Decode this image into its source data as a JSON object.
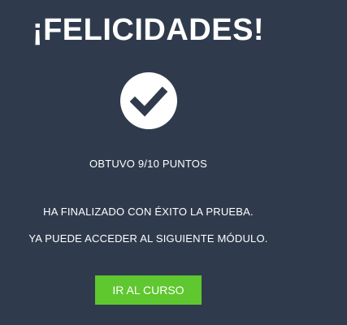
{
  "congrats": {
    "title": "¡FELICIDADES!",
    "icon": "check-circle-icon"
  },
  "result": {
    "score_text": "OBTUVO 9/10 PUNTOS"
  },
  "message": {
    "line1": "HA FINALIZADO CON ÉXITO LA PRUEBA.",
    "line2": "YA PUEDE ACCEDER AL SIGUIENTE MÓDULO."
  },
  "actions": {
    "go_to_course_label": "IR AL CURSO"
  },
  "colors": {
    "background": "#2f3b4d",
    "accent": "#5fc72f",
    "text": "#ffffff"
  }
}
